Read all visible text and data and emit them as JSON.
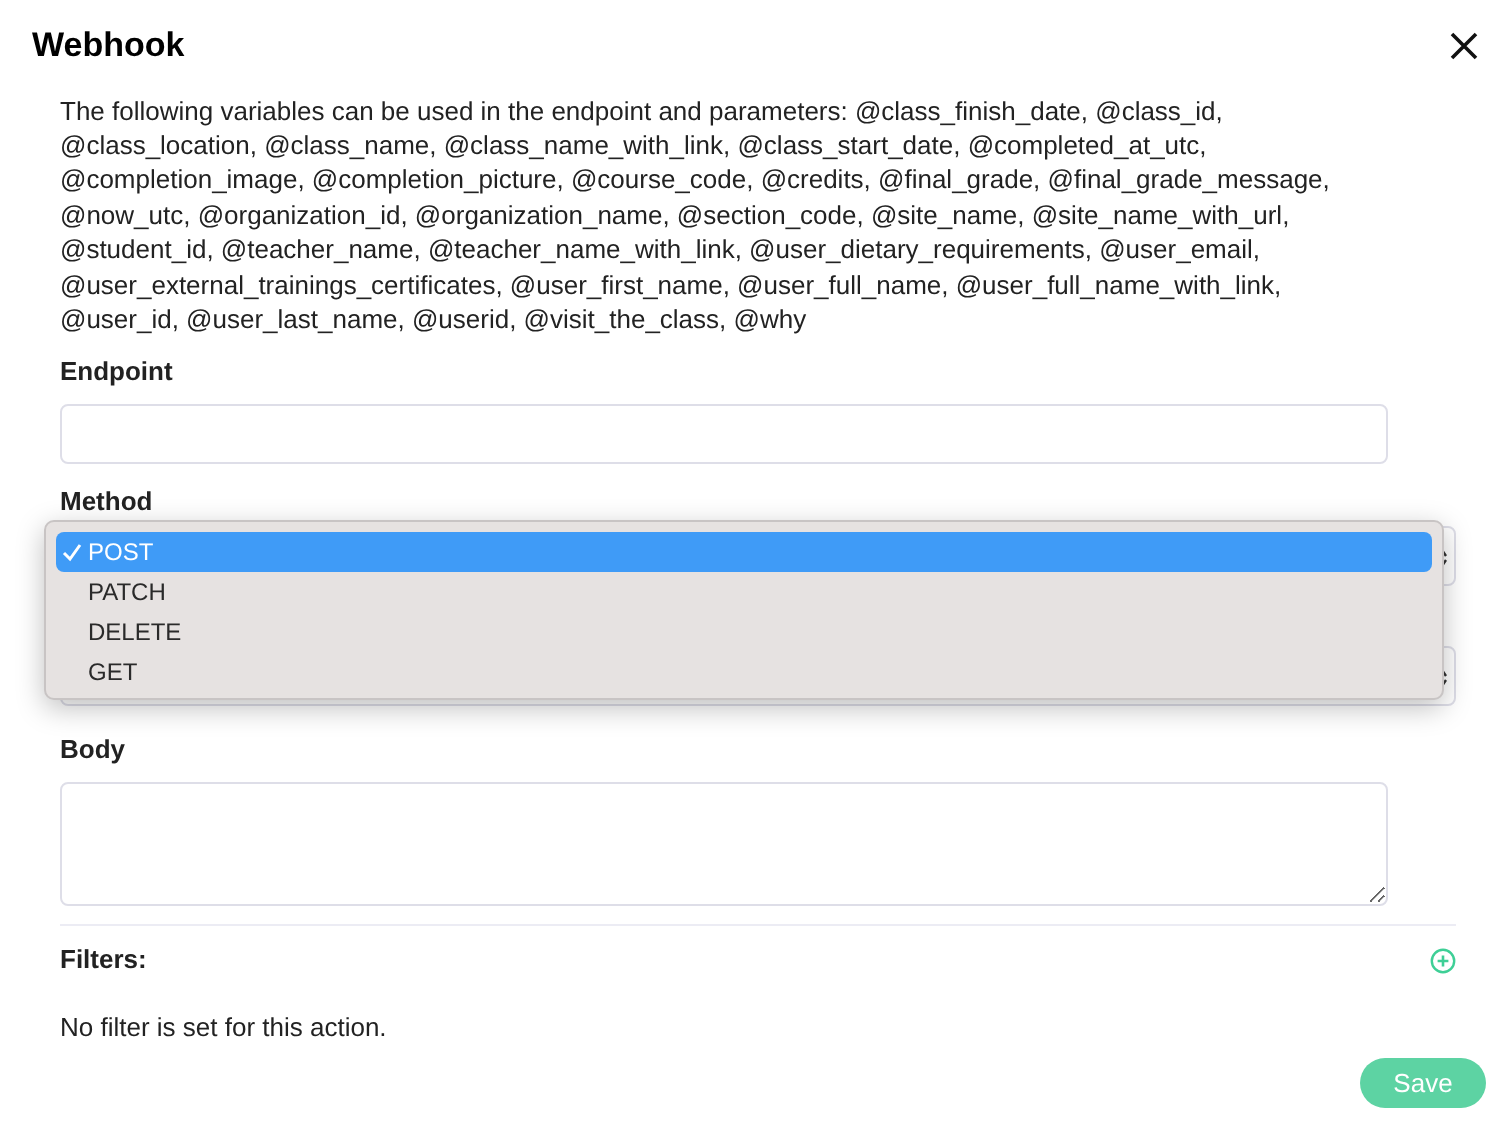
{
  "dialog": {
    "title": "Webhook"
  },
  "description": "The following variables can be used in the endpoint and parameters: @class_finish_date, @class_id, @class_location, @class_name, @class_name_with_link, @class_start_date, @completed_at_utc, @completion_image, @completion_picture, @course_code, @credits, @final_grade, @final_grade_message, @now_utc, @organization_id, @organization_name, @section_code, @site_name, @site_name_with_url, @student_id, @teacher_name, @teacher_name_with_link, @user_dietary_requirements, @user_email, @user_external_trainings_certificates, @user_first_name, @user_full_name, @user_full_name_with_link, @user_id, @user_last_name, @userid, @visit_the_class, @why",
  "endpoint": {
    "label": "Endpoint"
  },
  "method": {
    "label": "Method",
    "options": [
      {
        "label": "POST",
        "selected": true
      },
      {
        "label": "PATCH",
        "selected": false
      },
      {
        "label": "DELETE",
        "selected": false
      },
      {
        "label": "GET",
        "selected": false
      }
    ]
  },
  "body": {
    "label": "Body"
  },
  "filters": {
    "label": "Filters:",
    "empty_text": "No filter is set for this action."
  },
  "buttons": {
    "save": "Save"
  }
}
